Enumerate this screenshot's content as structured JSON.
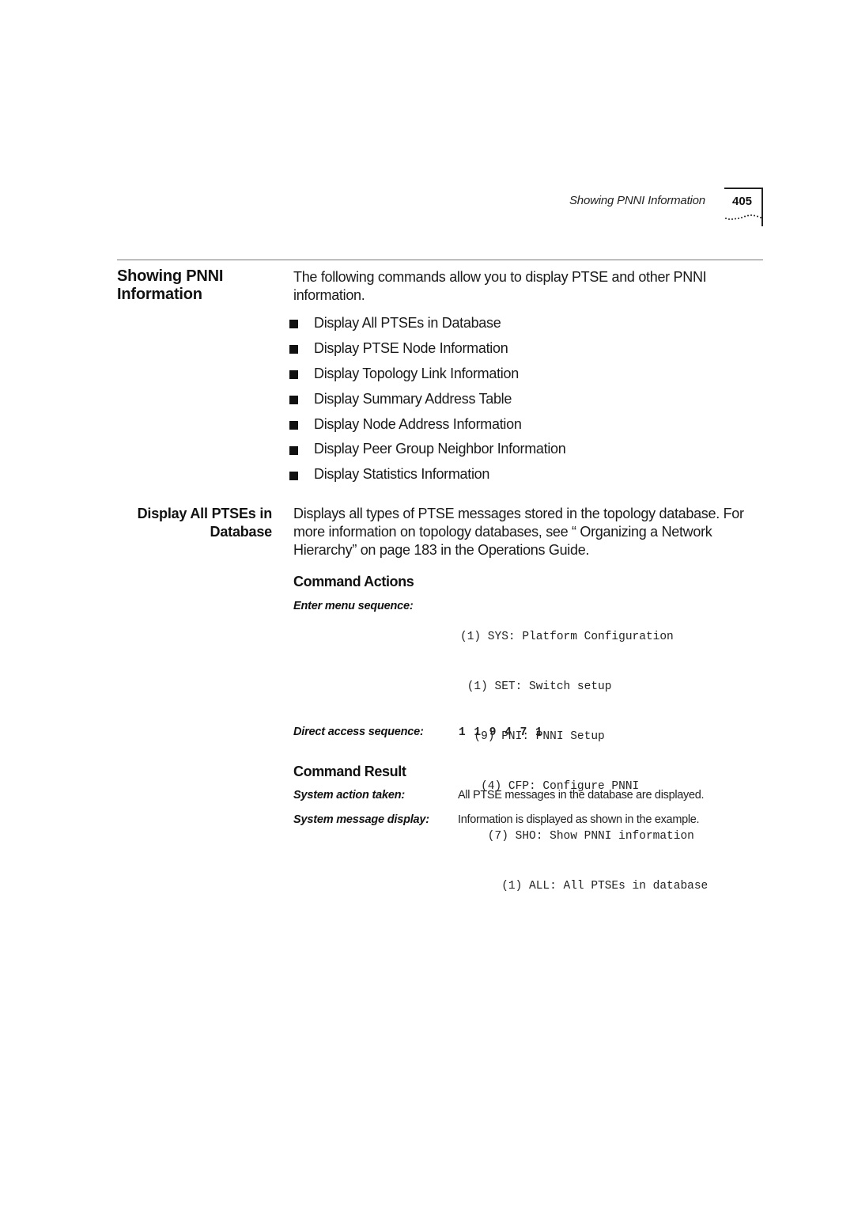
{
  "header": {
    "running_title": "Showing PNNI Information",
    "page_number": "405"
  },
  "section": {
    "heading_line1": "Showing PNNI",
    "heading_line2": "Information",
    "intro": "The following commands allow you to display PTSE and other PNNI information.",
    "bullets": [
      "Display All PTSEs in Database",
      "Display PTSE Node Information",
      "Display Topology Link Information",
      "Display Summary Address Table",
      "Display Node Address Information",
      "Display Peer Group Neighbor Information",
      "Display Statistics Information"
    ]
  },
  "subsection": {
    "heading_line1": "Display All PTSEs in",
    "heading_line2": "Database",
    "description": "Displays all types of PTSE messages stored in the topology database. For more information on topology databases, see “ Organizing a Network Hierarchy”  on page 183 in the Operations Guide.",
    "command_actions": {
      "title": "Command Actions",
      "enter_menu_label": "Enter menu sequence:",
      "menu_sequence": [
        "(1) SYS: Platform Configuration",
        " (1) SET: Switch setup",
        "  (9) PNI: PNNI Setup",
        "   (4) CFP: Configure PNNI",
        "    (7) SHO: Show PNNI information",
        "      (1) ALL: All PTSEs in database"
      ],
      "direct_access_label": "Direct access sequence:",
      "direct_access_sequence": "1 1 9 4 7 1"
    },
    "command_result": {
      "title": "Command Result",
      "action_label": "System action taken:",
      "action_value": "All PTSE messages in the database are displayed.",
      "message_label": "System message display:",
      "message_value": "Information is displayed as shown in the example."
    }
  }
}
